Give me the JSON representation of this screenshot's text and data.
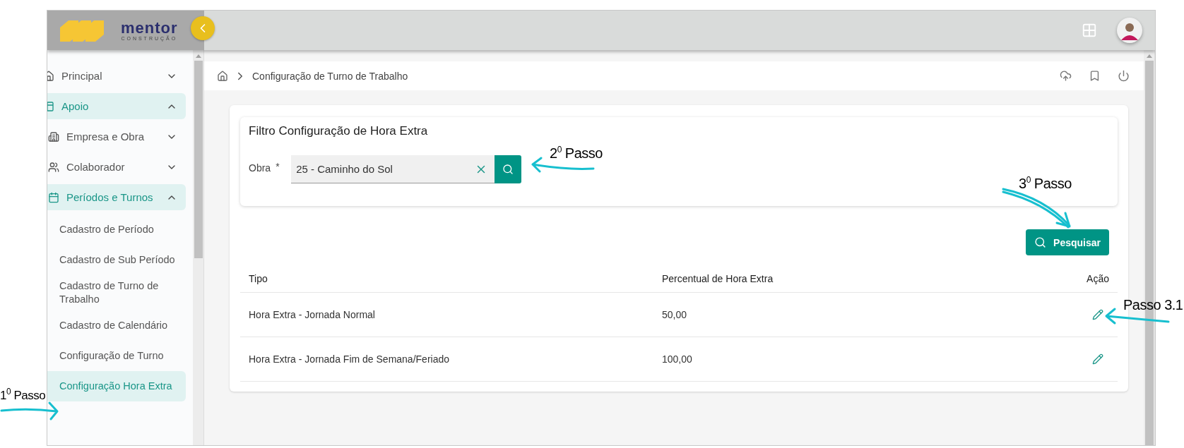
{
  "header": {
    "logo": {
      "name": "mentor",
      "tagline": "CONSTRUÇÃO"
    }
  },
  "sidebar": {
    "items": [
      {
        "label": "Principal",
        "expanded": false
      },
      {
        "label": "Apoio",
        "expanded": true,
        "children": [
          {
            "label": "Empresa e Obra",
            "expanded": false
          },
          {
            "label": "Colaborador",
            "expanded": false
          },
          {
            "label": "Períodos e Turnos",
            "expanded": true,
            "children": [
              {
                "label": "Cadastro de Período",
                "selected": false
              },
              {
                "label": "Cadastro de Sub Período",
                "selected": false
              },
              {
                "label": "Cadastro de Turno de Trabalho",
                "selected": false
              },
              {
                "label": "Cadastro de Calendário",
                "selected": false
              },
              {
                "label": "Configuração de Turno",
                "selected": false
              },
              {
                "label": "Configuração Hora Extra",
                "selected": true
              }
            ]
          }
        ]
      }
    ]
  },
  "breadcrumb": {
    "items": [
      "Configuração de Turno de Trabalho"
    ]
  },
  "filter": {
    "title": "Filtro Configuração de Hora Extra",
    "field": {
      "label": "Obra",
      "required_mark": "*",
      "value": "25 - Caminho do Sol"
    }
  },
  "search_button": {
    "label": "Pesquisar"
  },
  "table": {
    "columns": [
      "Tipo",
      "Percentual de Hora Extra",
      "Ação"
    ],
    "rows": [
      {
        "tipo": "Hora Extra - Jornada Normal",
        "percentual": "50,00"
      },
      {
        "tipo": "Hora Extra - Jornada Fim de Semana/Feriado",
        "percentual": "100,00"
      }
    ]
  },
  "annotations": [
    {
      "text": "1$^{0}$ Passo"
    },
    {
      "text": "2$^{0}$ Passo"
    },
    {
      "text": "3$^{0}$ Passo"
    },
    {
      "text": "Passo 3.1"
    }
  ]
}
